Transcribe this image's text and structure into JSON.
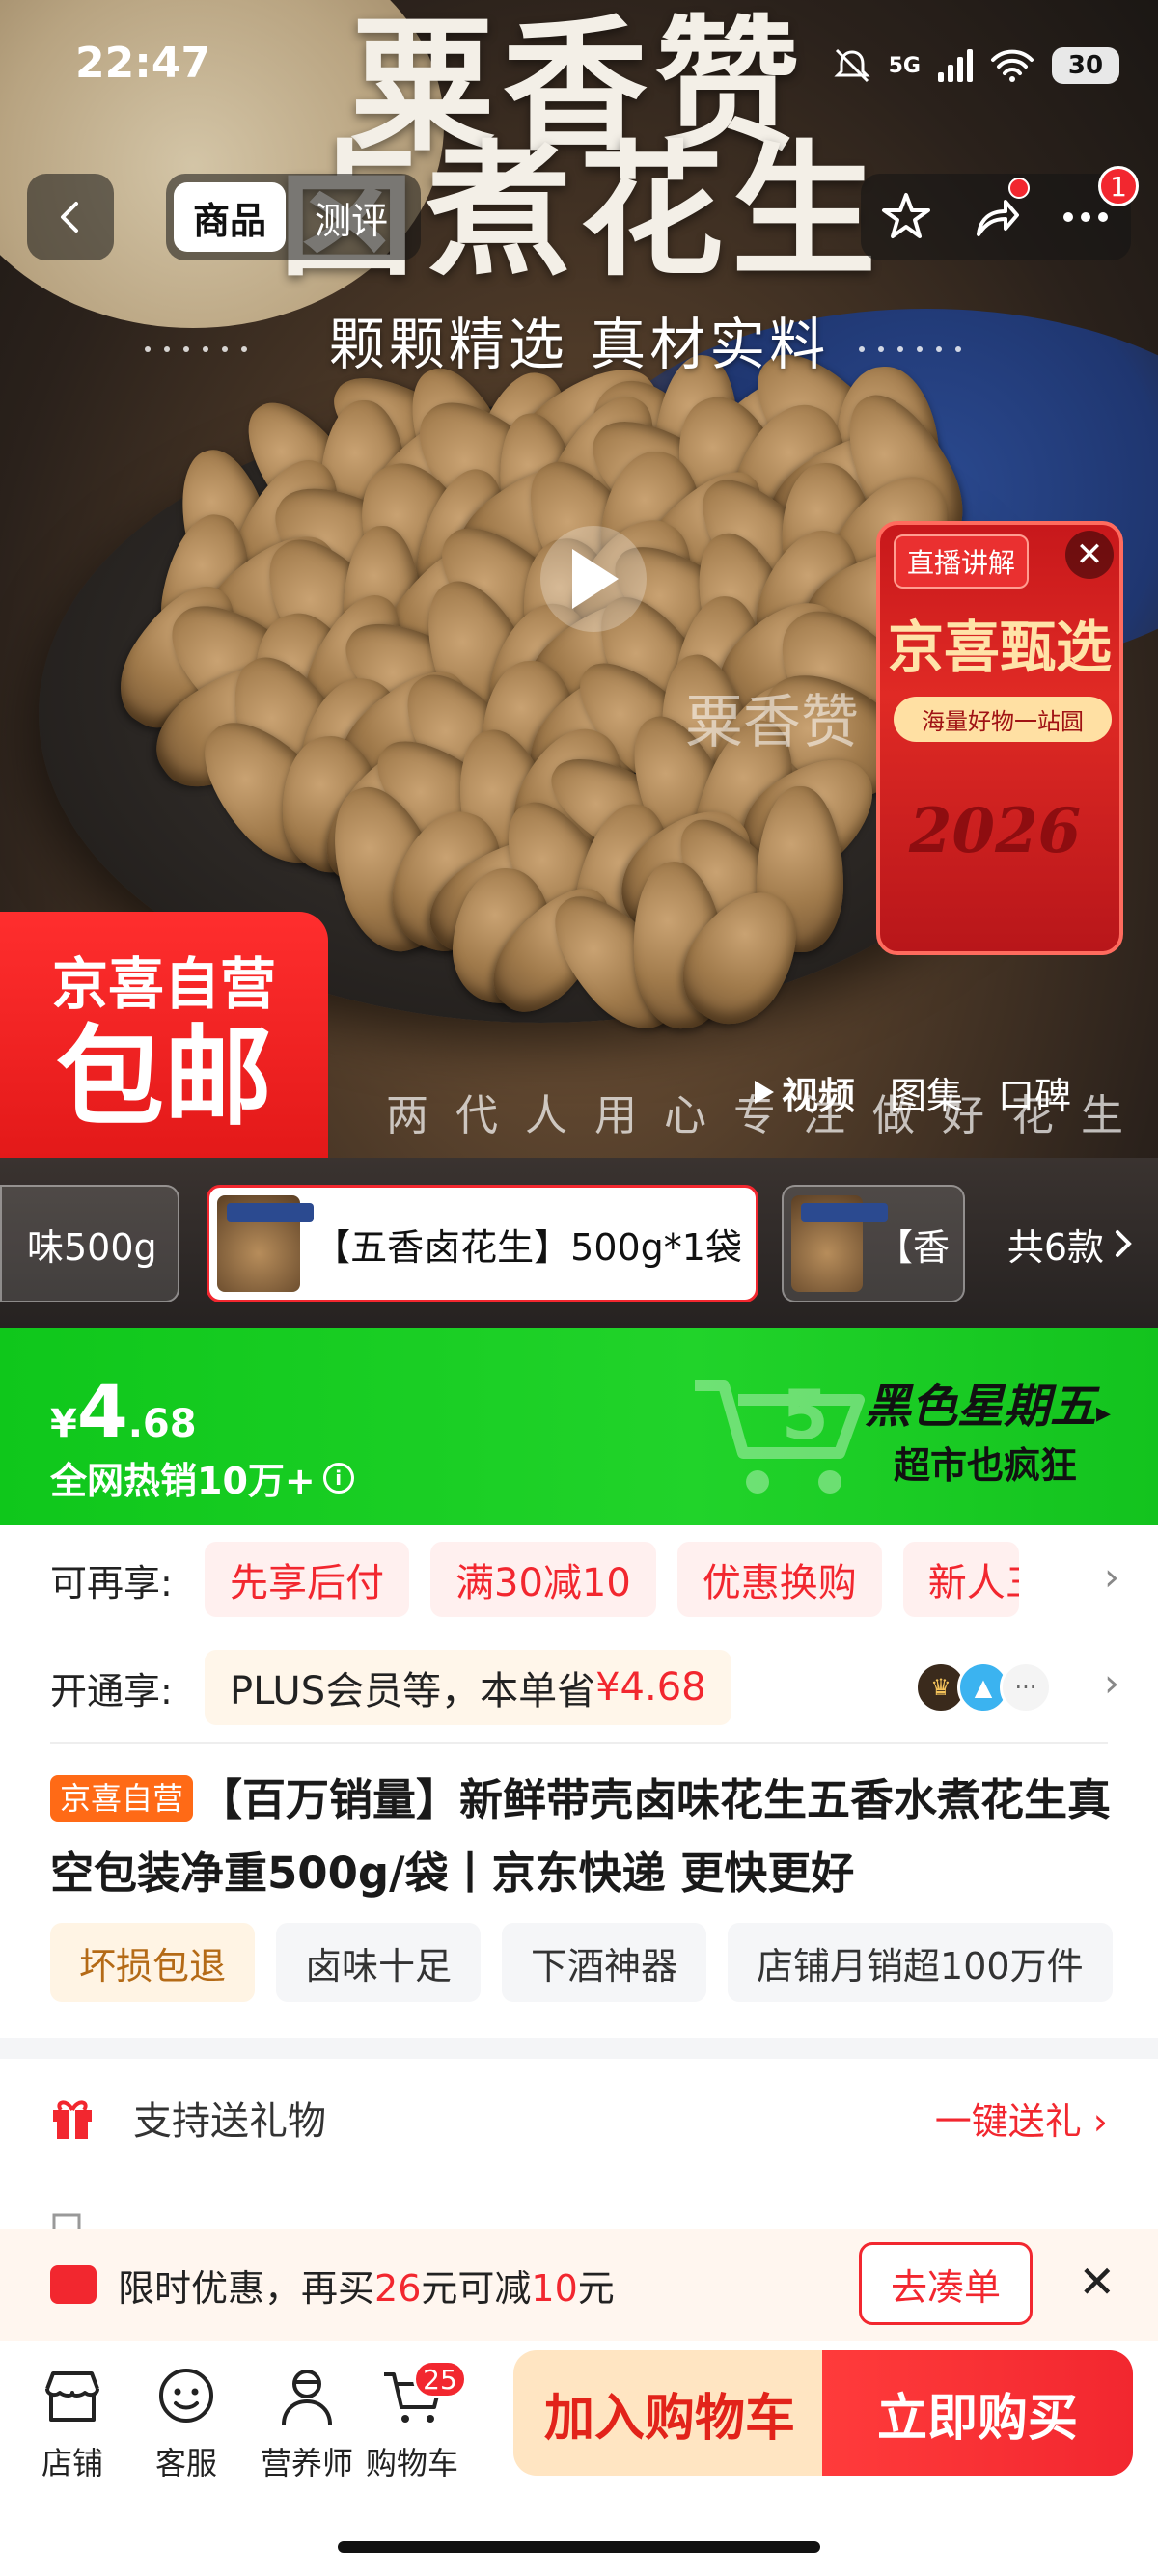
{
  "status_bar": {
    "time": "22:47",
    "network": "5G",
    "battery": "30"
  },
  "hero": {
    "title_line1": "粟香赞",
    "title_line2": "卤煮花生",
    "subtitle": "颗颗精选  真材实料",
    "watermark": "粟香赞",
    "bottom_slogan": "两代人用心专注做好花生"
  },
  "nav": {
    "tabs": [
      {
        "label": "商品"
      },
      {
        "label": "测评"
      }
    ],
    "more_badge": "1"
  },
  "live_widget": {
    "tag": "直播讲解",
    "title": "京喜甄选",
    "subtitle": "海量好物一站圆",
    "year": "2026"
  },
  "promo": {
    "line1": "京喜自营",
    "line2": "包邮"
  },
  "media_tabs": [
    {
      "label": "视频"
    },
    {
      "label": "图集"
    },
    {
      "label": "口碑"
    }
  ],
  "sku": {
    "items": [
      {
        "label": "味500g"
      },
      {
        "label": "【五香卤花生】500g*1袋"
      },
      {
        "label": "【香"
      }
    ],
    "count_label": "共6款"
  },
  "price_banner": {
    "currency": "¥",
    "price_int": "4",
    "price_dec": ".68",
    "hot_sale": "全网热销10万+",
    "event_title": "黑色星期五",
    "event_sub": "超市也疯狂"
  },
  "benefits": {
    "label": "可再享:",
    "chips": [
      {
        "label": "先享后付"
      },
      {
        "label": "满30减10"
      },
      {
        "label": "优惠换购"
      },
      {
        "label": "新人三"
      }
    ]
  },
  "membership": {
    "label": "开通享:",
    "text": "PLUS会员等，本单省",
    "amount": "¥4.68"
  },
  "product": {
    "badge": "京喜自营",
    "title": "【百万销量】新鲜带壳卤味花生五香水煮花生真空包装净重500g/袋丨京东快递 更快更好",
    "tags": [
      {
        "label": "坏损包退"
      },
      {
        "label": "卤味十足"
      },
      {
        "label": "下酒神器"
      },
      {
        "label": "店铺月销超100万件"
      }
    ]
  },
  "gift": {
    "text": "支持送礼物",
    "action": "一键送礼"
  },
  "discount_bar": {
    "prefix": "限时优惠，再买",
    "amount1": "26",
    "mid": "元可减",
    "amount2": "10",
    "suffix": "元",
    "button": "去凑单"
  },
  "bottom_bar": {
    "items": [
      {
        "label": "店铺"
      },
      {
        "label": "客服"
      },
      {
        "label": "营养师"
      },
      {
        "label": "购物车"
      }
    ],
    "cart_count": "25",
    "add_to_cart": "加入购物车",
    "buy_now": "立即购买"
  },
  "colors": {
    "accent_red": "#f2272f",
    "banner_green": "#21d32a",
    "promo_orange": "#ff6a16"
  }
}
